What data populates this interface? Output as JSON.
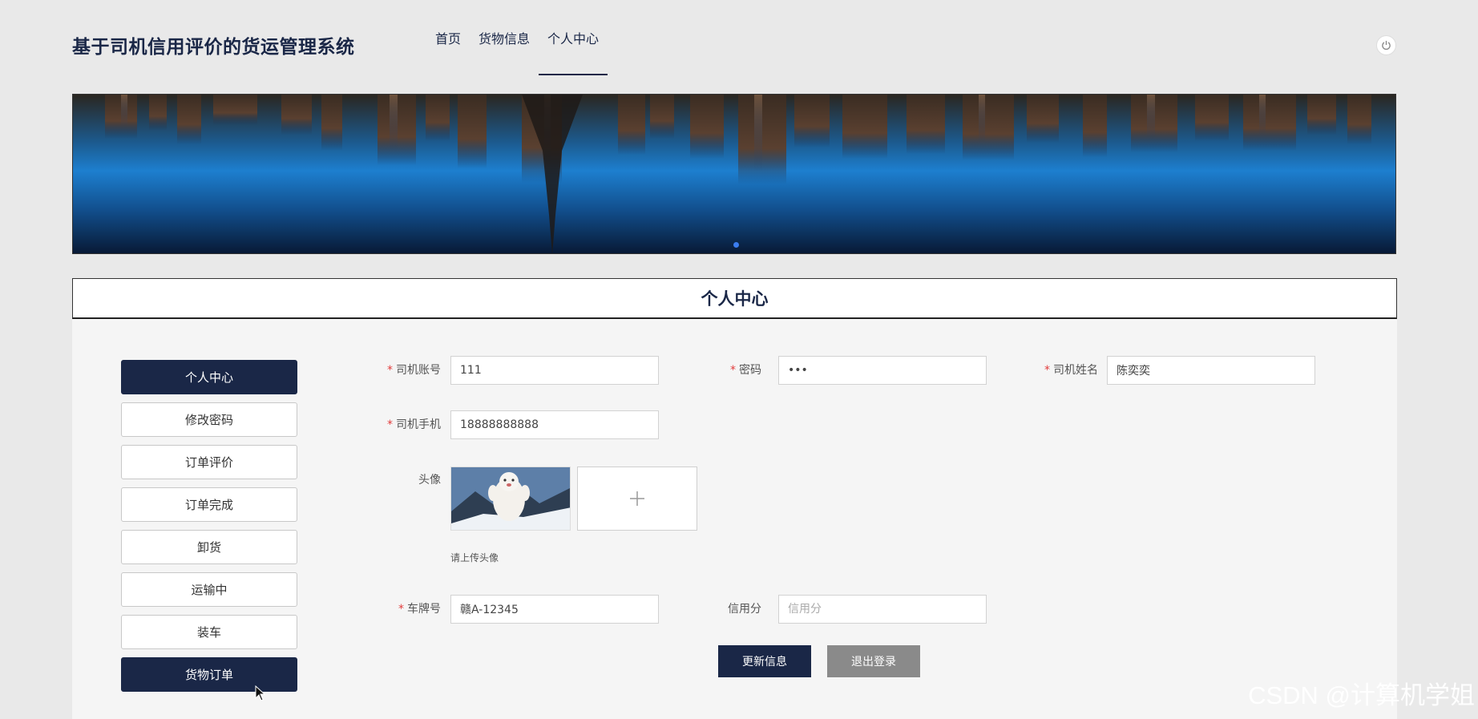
{
  "header": {
    "site_title": "基于司机信用评价的货运管理系统",
    "nav": [
      {
        "label": "首页",
        "active": false
      },
      {
        "label": "货物信息",
        "active": false
      },
      {
        "label": "个人中心",
        "active": true
      }
    ],
    "power_icon": "power-icon"
  },
  "banner": {
    "slide_count": 1,
    "active_slide": 1
  },
  "section": {
    "title": "个人中心"
  },
  "side_menu": [
    {
      "label": "个人中心",
      "style": "dark"
    },
    {
      "label": "修改密码",
      "style": "light"
    },
    {
      "label": "订单评价",
      "style": "light"
    },
    {
      "label": "订单完成",
      "style": "light"
    },
    {
      "label": "卸货",
      "style": "light"
    },
    {
      "label": "运输中",
      "style": "light"
    },
    {
      "label": "装车",
      "style": "light"
    },
    {
      "label": "货物订单",
      "style": "dark"
    }
  ],
  "form": {
    "account": {
      "label": "司机账号",
      "required": true,
      "value": "111"
    },
    "password": {
      "label": "密码",
      "required": true,
      "value": "•••"
    },
    "name": {
      "label": "司机姓名",
      "required": true,
      "value": "陈奕奕"
    },
    "phone": {
      "label": "司机手机",
      "required": true,
      "value": "18888888888"
    },
    "avatar": {
      "label": "头像",
      "hint": "请上传头像",
      "upload_icon": "plus-icon"
    },
    "plate": {
      "label": "车牌号",
      "required": true,
      "value": "赣A-12345"
    },
    "credit": {
      "label": "信用分",
      "required": false,
      "value": "",
      "placeholder": "信用分"
    }
  },
  "buttons": {
    "update": "更新信息",
    "logout": "退出登录"
  },
  "watermark": "CSDN @计算机学姐",
  "colors": {
    "primary": "#1a2747",
    "required": "#e23c3c",
    "secondary_button": "#8a8a8a"
  }
}
